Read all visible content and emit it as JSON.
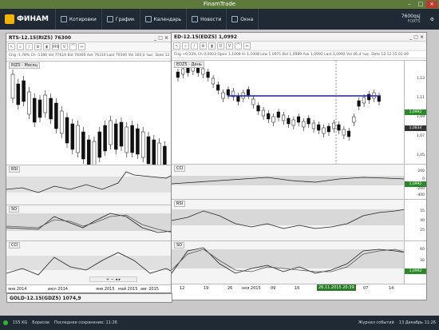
{
  "app": {
    "title": "FinamTrade"
  },
  "toolbar": {
    "brand": "ФИНАМ",
    "items": [
      "Котировки",
      "График",
      "Календарь",
      "Новости",
      "Окна"
    ],
    "account": "7600qsj",
    "account_sub": "FORTS"
  },
  "left_window": {
    "title": "RTS-12.15(RIZ5) 76300",
    "quote": "Chg -1,78%   Ch  -1380  Vol  77610  Bid 76300  Ask 76310  Last 76300  Vol 164,0 тыс.  Date 12.12.15",
    "main_label": "RIZ5 - Месяц",
    "candles": [
      [
        30,
        40,
        8,
        22
      ],
      [
        36,
        44,
        20,
        30
      ],
      [
        40,
        48,
        16,
        26
      ],
      [
        46,
        54,
        30,
        42
      ],
      [
        52,
        60,
        38,
        52
      ],
      [
        58,
        66,
        40,
        46
      ],
      [
        64,
        70,
        34,
        40
      ],
      [
        70,
        78,
        38,
        48
      ],
      [
        76,
        84,
        44,
        60
      ],
      [
        82,
        90,
        54,
        66
      ],
      [
        88,
        96,
        62,
        78
      ],
      [
        94,
        100,
        70,
        86
      ],
      [
        100,
        108,
        72,
        90
      ],
      [
        106,
        114,
        80,
        98
      ],
      [
        112,
        120,
        90,
        108
      ],
      [
        118,
        126,
        92,
        110
      ],
      [
        124,
        130,
        80,
        96
      ],
      [
        130,
        136,
        72,
        88
      ],
      [
        136,
        142,
        66,
        80
      ],
      [
        142,
        148,
        70,
        86
      ],
      [
        148,
        156,
        68,
        82
      ],
      [
        154,
        160,
        74,
        90
      ],
      [
        160,
        166,
        72,
        90
      ],
      [
        166,
        172,
        76,
        92
      ],
      [
        172,
        178,
        80,
        96
      ],
      [
        178,
        184,
        86,
        104
      ],
      [
        184,
        190,
        90,
        110
      ],
      [
        190,
        196,
        94,
        112
      ],
      [
        196,
        202,
        98,
        114
      ]
    ],
    "indicators": [
      "RSI",
      "SO",
      "CCI"
    ],
    "dates": [
      "янв 2014",
      "июл 2014",
      "янв 2015",
      "май 2015",
      "авг 2015"
    ]
  },
  "right_window": {
    "title": "ED-12.15(EDZ5) 1,0992",
    "quote": "Chg +0,03%   Ch  0,0003  Open 1,1008  Hi 1,1008  Low 1,0971  Bid 1,0989  Ask 1,0992  Last 1,0992  Vol 46,4 тыс.  Date 12.12.15 01:49",
    "main_label": "EDZ5 - День",
    "y_ticks": [
      "1,13",
      "1,11",
      "1,09",
      "1,07",
      "1,05"
    ],
    "last_price": "1,0992",
    "marker_price": "1,0834",
    "cci_ticks": [
      "200",
      "0",
      "-200",
      "-400"
    ],
    "cci_value": "1,0992",
    "rsi_ticks": [
      "55",
      "40",
      "25"
    ],
    "so_ticks": [
      "60",
      "30"
    ],
    "so_value": "1,0992",
    "dates": [
      "12",
      "19",
      "26",
      "ноя 2015",
      "09",
      "16",
      "",
      "07",
      "14"
    ],
    "cursor_time": "26.11.2015 20:39",
    "pane_labels": [
      "CCI",
      "RSI",
      "SO"
    ]
  },
  "bottom_window": {
    "title": "GOLD-12.15(GDZ5) 1074,9"
  },
  "status": {
    "connection": "155 KG",
    "server": "Борисов",
    "saved": "Последнее сохранение: 11:26",
    "journal": "Журнал событий",
    "date": "13 Декабрь 11:26"
  },
  "colors": {
    "accent": "#5d7a3a",
    "dark": "#1f2a35",
    "price_line": "#1a1ad6",
    "green": "#2a8a2a"
  }
}
